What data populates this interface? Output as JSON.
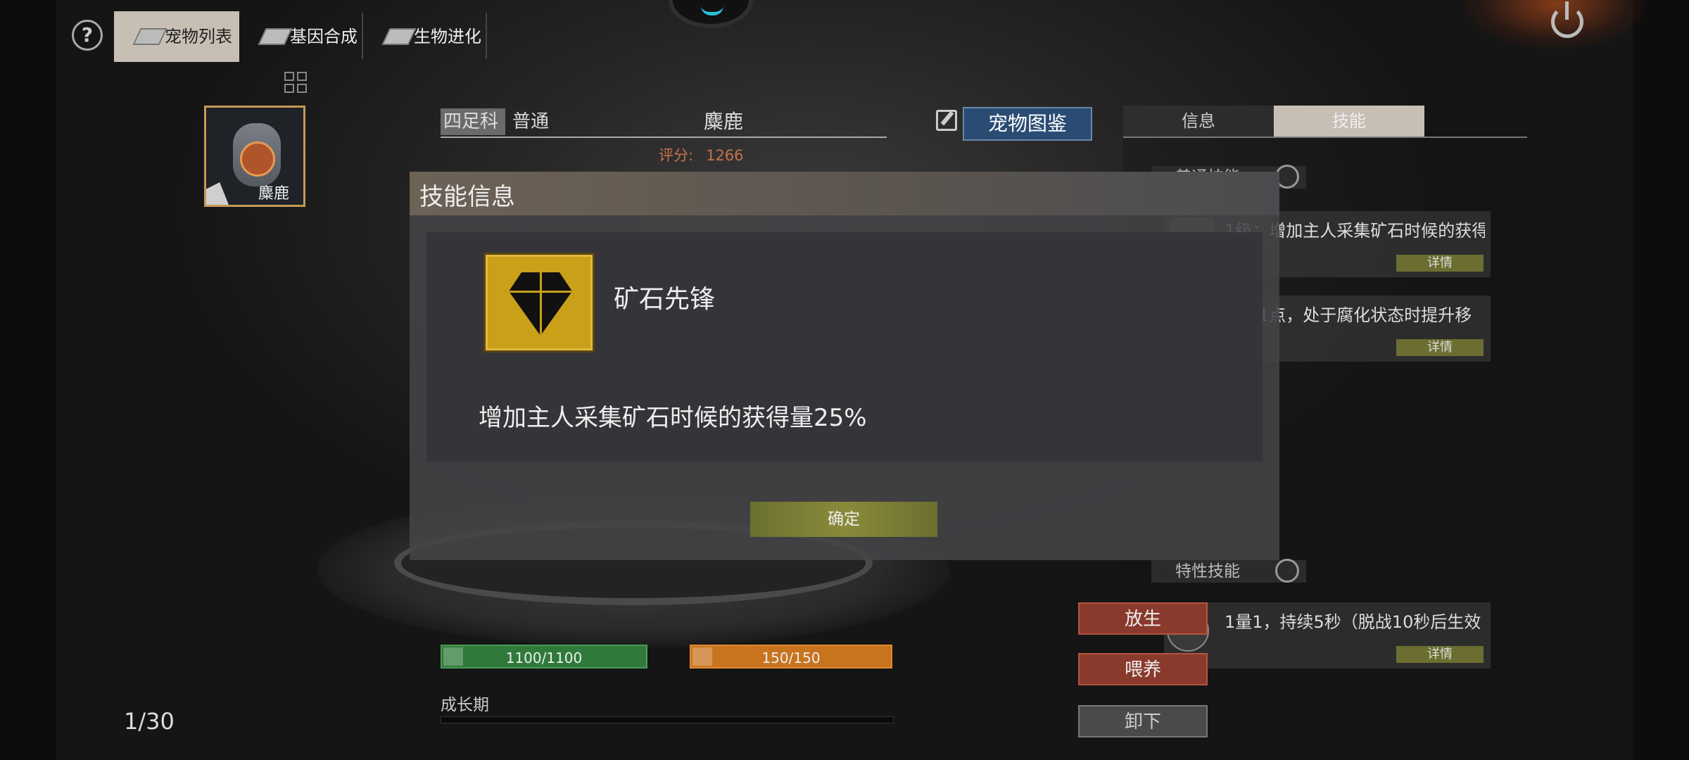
{
  "top_bar": {
    "help_label": "?",
    "tabs": [
      {
        "label": "宠物列表",
        "active": true
      },
      {
        "label": "基因合成",
        "active": false
      },
      {
        "label": "生物进化",
        "active": false
      }
    ]
  },
  "pet_card": {
    "name": "麋鹿"
  },
  "pet_header": {
    "family": "四足科",
    "rarity": "普通",
    "name": "麋鹿",
    "score_label": "评分:",
    "score_value": "1266",
    "atlas_button": "宠物图鉴"
  },
  "right_panel": {
    "tabs": [
      {
        "label": "信息",
        "active": false
      },
      {
        "label": "技能",
        "active": true
      }
    ],
    "normal_skill_label": "普通技能",
    "trait_skill_label": "特性技能",
    "skills": [
      {
        "desc": "1级：增加主人采集矿石时候的获得",
        "detail": "详情"
      },
      {
        "desc": "防御1点，处于腐化状态时提升移",
        "detail": "详情"
      }
    ],
    "trait_skills": [
      {
        "desc": "1量1，持续5秒（脱战10秒后生效",
        "detail": "详情"
      }
    ]
  },
  "actions": {
    "release": "放生",
    "feed": "喂养",
    "unload": "卸下"
  },
  "stats": {
    "hp": "1100/1100",
    "hunger": "150/150",
    "growth_label": "成长期"
  },
  "page_count": "1/30",
  "modal": {
    "title": "技能信息",
    "skill_name": "矿石先锋",
    "skill_desc": "增加主人采集矿石时候的获得量25%",
    "confirm": "确定"
  },
  "colors": {
    "accent_gold": "#caa019",
    "release_red": "#8a3a2c",
    "hp_green": "#2f7a3a",
    "hunger_orange": "#c8741e",
    "atlas_blue": "#2a4c73",
    "confirm_olive": "#8a8a3a"
  }
}
